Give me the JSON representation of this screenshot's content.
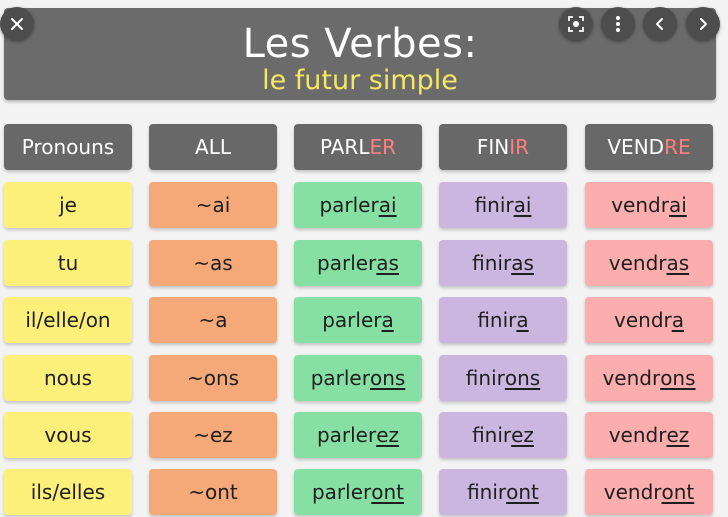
{
  "banner": {
    "title": "Les Verbes:",
    "subtitle": "le futur simple"
  },
  "headers": [
    {
      "text": "Pronouns"
    },
    {
      "text": "ALL"
    },
    {
      "stem": "PARL",
      "ending": "ER"
    },
    {
      "stem": "FIN",
      "ending": "IR"
    },
    {
      "stem": "VEND",
      "ending": "RE"
    }
  ],
  "rows": [
    {
      "pronoun": "je",
      "all": "~ai",
      "parler": {
        "stem": "parler",
        "ending": "ai"
      },
      "finir": {
        "stem": "finir",
        "ending": "ai"
      },
      "vendre": {
        "stem": "vendr",
        "ending": "ai"
      }
    },
    {
      "pronoun": "tu",
      "all": "~as",
      "parler": {
        "stem": "parler",
        "ending": "as"
      },
      "finir": {
        "stem": "finir",
        "ending": "as"
      },
      "vendre": {
        "stem": "vendr",
        "ending": "as"
      }
    },
    {
      "pronoun": "il/elle/on",
      "all": "~a",
      "parler": {
        "stem": "parler",
        "ending": "a"
      },
      "finir": {
        "stem": "finir",
        "ending": "a"
      },
      "vendre": {
        "stem": "vendr",
        "ending": "a"
      }
    },
    {
      "pronoun": "nous",
      "all": "~ons",
      "parler": {
        "stem": "parler",
        "ending": "ons"
      },
      "finir": {
        "stem": "finir",
        "ending": "ons"
      },
      "vendre": {
        "stem": "vendr",
        "ending": "ons"
      }
    },
    {
      "pronoun": "vous",
      "all": "~ez",
      "parler": {
        "stem": "parler",
        "ending": "ez"
      },
      "finir": {
        "stem": "finir",
        "ending": "ez"
      },
      "vendre": {
        "stem": "vendr",
        "ending": "ez"
      }
    },
    {
      "pronoun": "ils/elles",
      "all": "~ont",
      "parler": {
        "stem": "parler",
        "ending": "ont"
      },
      "finir": {
        "stem": "finir",
        "ending": "ont"
      },
      "vendre": {
        "stem": "vendr",
        "ending": "ont"
      }
    }
  ],
  "colors": {
    "pronoun": "#fdf07a",
    "all": "#f6a978",
    "parler": "#86e0a3",
    "finir": "#cbb6df",
    "vendre": "#fcadad",
    "header": "#686868",
    "banner": "#6b6b6b",
    "accent": "#ff7f7f",
    "subtitle": "#f5e663"
  },
  "controls": {
    "close": "close-icon",
    "lens": "visual-search-icon",
    "more": "more-vert-icon",
    "prev": "chevron-left-icon",
    "next": "chevron-right-icon"
  }
}
